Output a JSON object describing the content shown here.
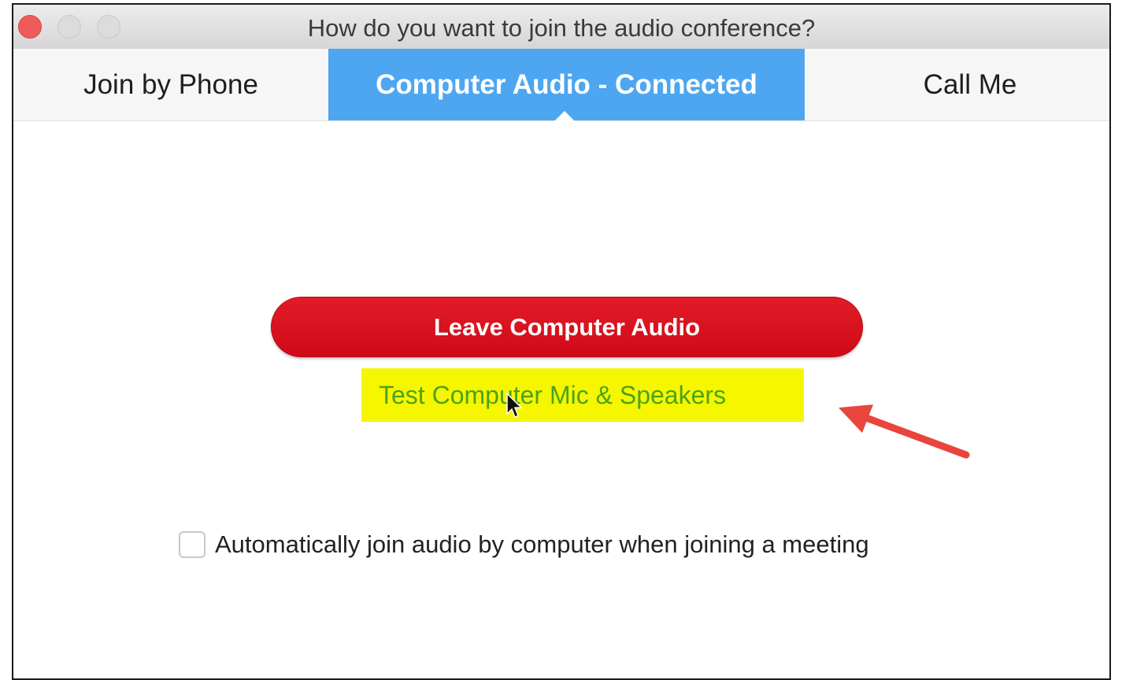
{
  "window": {
    "title": "How do you want to join the audio conference?"
  },
  "tabs": [
    {
      "label": "Join by Phone",
      "selected": false
    },
    {
      "label": "Computer Audio - Connected",
      "selected": true
    },
    {
      "label": "Call Me",
      "selected": false
    }
  ],
  "main": {
    "leave_button_label": "Leave Computer Audio",
    "test_link_label": "Test Computer Mic & Speakers",
    "auto_join_label": "Automatically join audio by computer when joining a meeting",
    "auto_join_checked": false
  },
  "colors": {
    "selected_tab": "#4ea6f1",
    "leave_button": "#d90f1c",
    "highlight": "#f6f600",
    "link_text": "#4aa417",
    "annotation_arrow": "#e8453c"
  },
  "icons": {
    "close": "close-icon",
    "minimize": "minimize-icon",
    "maximize": "maximize-icon",
    "cursor": "mouse-pointer-icon",
    "annotation": "red-arrow-icon"
  }
}
